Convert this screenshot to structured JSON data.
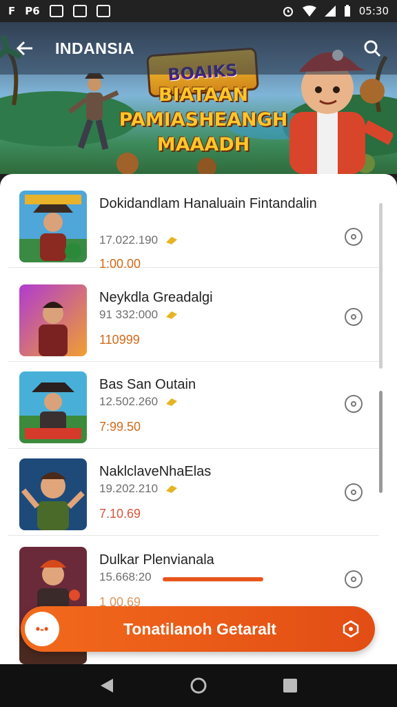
{
  "status_bar": {
    "left_text_1": "P6",
    "time": "05:30"
  },
  "app_bar": {
    "title": "INDANSIA",
    "back_icon": "arrow-left-icon",
    "search_icon": "search-icon"
  },
  "banner": {
    "logo_text": "BOAIKS",
    "headline_lines": [
      "BIATAAN",
      "PAMIASHEANGH",
      "MAAADH"
    ]
  },
  "items": [
    {
      "title": "Dokidandlam Hanaluain Fintandalin",
      "meta": "17.022.190",
      "price": "1:00.00"
    },
    {
      "title": "Neykdla Greadalgi",
      "meta": "91 332:000",
      "price": "110999"
    },
    {
      "title": "Bas San Outain",
      "meta": "12.502.260",
      "price": "7:99.50"
    },
    {
      "title": "NaklclaveNhaElas",
      "meta": "19.202.210",
      "price": "7.10.69"
    },
    {
      "title": "Dulkar Plenvianala",
      "meta": "15.668:20",
      "price": "1 00.69"
    }
  ],
  "cta": {
    "left_glyph": "•-•",
    "label": "Tonatilanoh Getaralt",
    "right_icon": "share-hex-icon"
  },
  "colors": {
    "accent": "#e8541c",
    "price": "#d06a1a"
  }
}
